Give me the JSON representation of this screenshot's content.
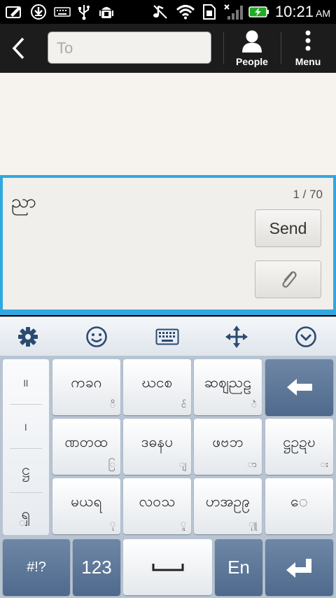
{
  "status_bar": {
    "time": "10:21",
    "ampm": "AM",
    "icons": [
      "edit-icon",
      "download-icon",
      "keyboard-icon",
      "usb-icon",
      "android-debug-icon",
      "mute-icon",
      "wifi-icon",
      "sim-card-icon",
      "no-signal-icon",
      "battery-charging-icon"
    ]
  },
  "action_bar": {
    "to_placeholder": "To",
    "people_label": "People",
    "menu_label": "Menu"
  },
  "compose": {
    "message_text": "ညာ",
    "counter": "1 / 70",
    "send_label": "Send"
  },
  "keyboard": {
    "toolbar_icons": [
      "settings-icon",
      "smiley-icon",
      "keyboard-icon",
      "move-icon",
      "collapse-icon"
    ],
    "left_column": [
      "။",
      "၊",
      "ဋ္ဌ",
      "ၡ္"
    ],
    "rows": [
      [
        {
          "main": "ကခဂ",
          "sub": "ိ"
        },
        {
          "main": "ဃငစ",
          "sub": "င်"
        },
        {
          "main": "ဆဈညဠ",
          "sub": "ံဲ"
        }
      ],
      [
        {
          "main": "ဏတထ",
          "sub": "ြ"
        },
        {
          "main": "ဒဓနပ",
          "sub": "ျ"
        },
        {
          "main": "ဖဗဘ",
          "sub": "ာ"
        },
        {
          "main": "ဋ္ဌဥဍဎ",
          "sub": "း"
        }
      ],
      [
        {
          "main": "မယရ",
          "sub": "ု"
        },
        {
          "main": "လဝသ",
          "sub": "ူ"
        },
        {
          "main": "ဟအဥ၉",
          "sub": "ုူ"
        },
        {
          "main": "ေ",
          "sub": ""
        }
      ]
    ],
    "bottom": {
      "symbols_label": "#!?",
      "numbers_label": "123",
      "space_label": "⎵",
      "lang_label": "En"
    }
  }
}
